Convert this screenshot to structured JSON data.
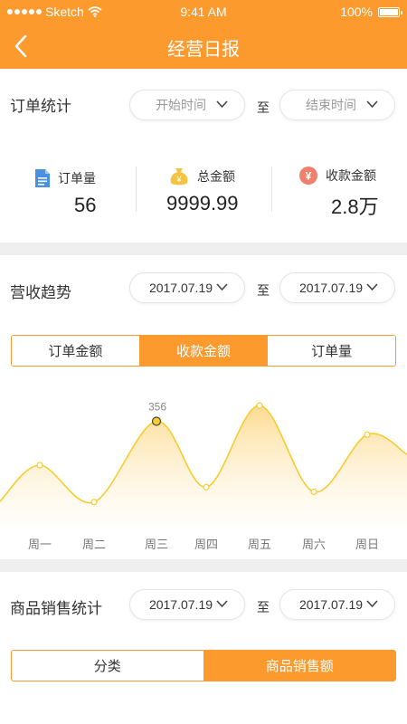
{
  "status_bar": {
    "carrier": "Sketch",
    "time": "9:41 AM",
    "battery": "100%"
  },
  "nav": {
    "title": "经营日报"
  },
  "order_stats": {
    "title": "订单统计",
    "start_placeholder": "开始时间",
    "to_label": "至",
    "end_placeholder": "结束时间",
    "order_count": {
      "label": "订单量",
      "value": "56"
    },
    "total_amount": {
      "label": "总金额",
      "value": "9999.99"
    },
    "received_amount": {
      "label": "收款金额",
      "value": "2.8万"
    }
  },
  "revenue_trend": {
    "title": "营收趋势",
    "start_date": "2017.07.19",
    "to_label": "至",
    "end_date": "2017.07.19",
    "tabs": [
      {
        "label": "订单金额",
        "active": false
      },
      {
        "label": "收款金额",
        "active": true
      },
      {
        "label": "订单量",
        "active": false
      }
    ],
    "highlight_label": "356"
  },
  "chart_data": {
    "type": "area",
    "categories": [
      "周一",
      "周二",
      "周三",
      "周四",
      "周五",
      "周六",
      "周日"
    ],
    "series": [
      {
        "values": [
          300,
          253,
          356,
          272,
          376,
          266,
          339
        ]
      }
    ],
    "highlight_index": 2,
    "ylim": [
      180,
      420
    ],
    "line_color": "#f7cc2e",
    "fill_color": "#fde6b0"
  },
  "product_sales": {
    "title": "商品销售统计",
    "start_date": "2017.07.19",
    "to_label": "至",
    "end_date": "2017.07.19",
    "tabs": [
      {
        "label": "分类",
        "active": false
      },
      {
        "label": "商品销售额",
        "active": true
      }
    ]
  },
  "colors": {
    "accent": "#fc9a2e",
    "doc_icon": "#4a90e2",
    "money_bag": "#f5c342",
    "yen_icon": "#f0806e"
  }
}
